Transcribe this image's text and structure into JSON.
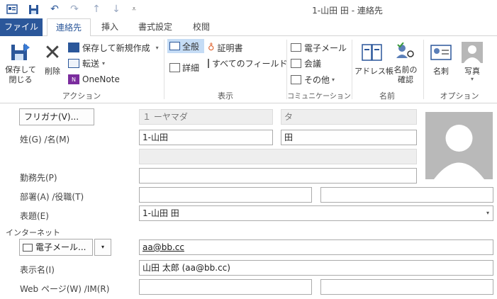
{
  "window": {
    "title": "1-山田 田 - 連絡先"
  },
  "tabs": [
    {
      "label": "ファイル"
    },
    {
      "label": "連絡先"
    },
    {
      "label": "挿入"
    },
    {
      "label": "書式設定"
    },
    {
      "label": "校閲"
    }
  ],
  "ribbon": {
    "actions": {
      "save_close": [
        "保存して",
        "閉じる"
      ],
      "delete": "削除",
      "save_new": "保存して新規作成",
      "forward": "転送",
      "onenote": "OneNote",
      "group": "アクション"
    },
    "show": {
      "general": "全般",
      "details": "詳細",
      "certificates": "証明書",
      "all_fields": "すべてのフィールド",
      "group": "表示"
    },
    "communicate": {
      "email": "電子メール",
      "meeting": "会議",
      "more": "その他",
      "group": "コミュニケーション"
    },
    "names": {
      "address_book": "アドレス帳",
      "check_names": [
        "名前の",
        "確認"
      ],
      "group": "名前"
    },
    "options": {
      "business_card": "名刺",
      "picture": "写真",
      "group": "オプション"
    }
  },
  "form": {
    "furigana_button": "フリガナ(V)...",
    "furigana_last": "１ ーヤマダ",
    "furigana_first": "タ",
    "name_label": "姓(G)  /名(M)",
    "last_name": "1-山田",
    "first_name": "田",
    "company_label": "勤務先(P)",
    "company": "",
    "dept_label": "部署(A)  /役職(T)",
    "department": "",
    "job_title": "",
    "file_as_label": "表題(E)",
    "file_as": "1-山田 田",
    "internet_label": "インターネット",
    "email_button": "電子メール...",
    "email": "aa@bb.cc",
    "display_name_label": "表示名(I)",
    "display_name": "山田 太郎 (aa@bb.cc)",
    "web_label": "Web ページ(W)  /IM(R)",
    "web_page": "",
    "im_address": ""
  }
}
